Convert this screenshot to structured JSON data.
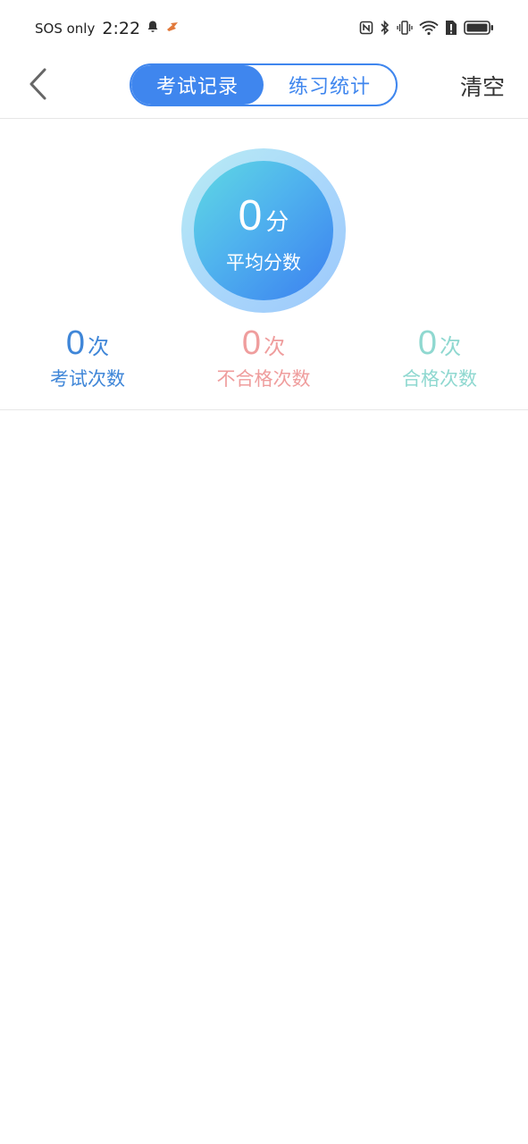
{
  "status_bar": {
    "carrier": "SOS only",
    "time": "2:22",
    "icons": [
      "bell-icon",
      "app-notification-icon",
      "nfc-icon",
      "bluetooth-icon",
      "vibrate-icon",
      "wifi-icon",
      "sim-alert-icon",
      "battery-icon"
    ]
  },
  "header": {
    "tabs": [
      {
        "label": "考试记录",
        "active": true
      },
      {
        "label": "练习统计",
        "active": false
      }
    ],
    "clear_label": "清空"
  },
  "score": {
    "value": "0",
    "unit": "分",
    "label": "平均分数"
  },
  "stats": [
    {
      "value": "0",
      "unit": "次",
      "label": "考试次数",
      "color": "#3f86d8"
    },
    {
      "value": "0",
      "unit": "次",
      "label": "不合格次数",
      "color": "#ef9d9d"
    },
    {
      "value": "0",
      "unit": "次",
      "label": "合格次数",
      "color": "#8fd8d0"
    }
  ],
  "colors": {
    "accent": "#3f86ee"
  }
}
